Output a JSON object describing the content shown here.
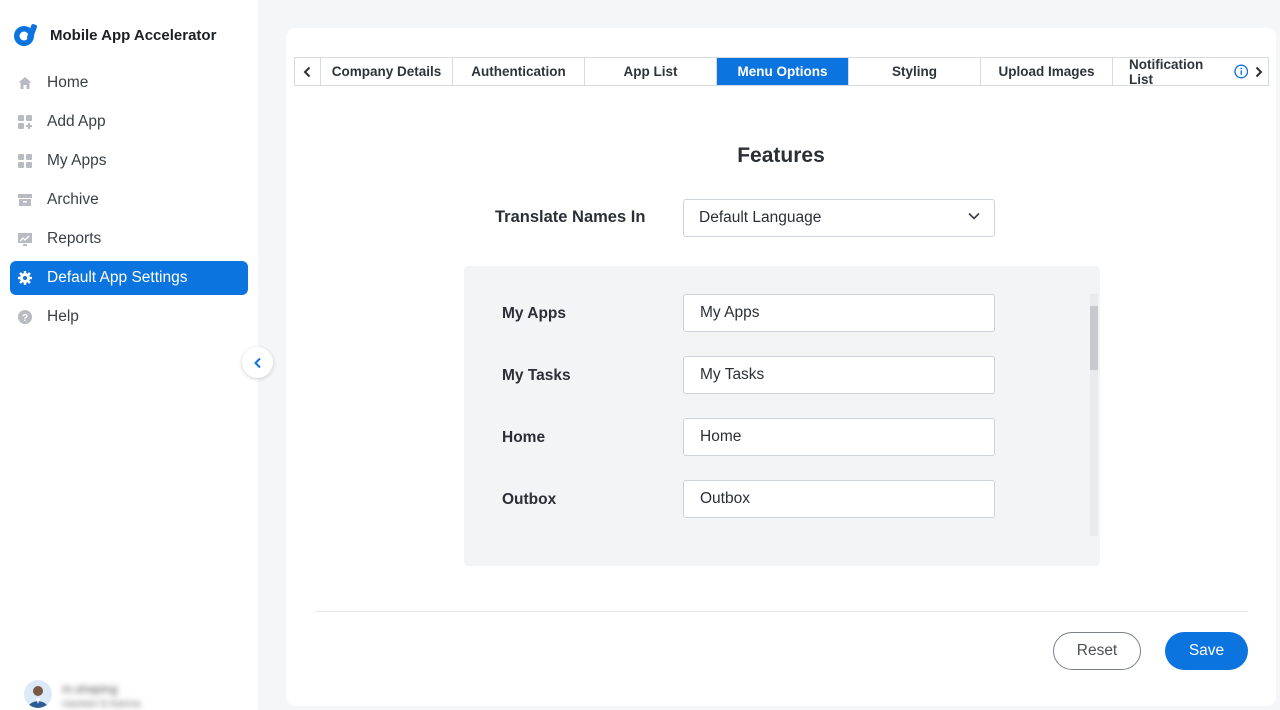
{
  "app": {
    "title": "Mobile App Accelerator",
    "accent": "#0b74de"
  },
  "sidebar": {
    "items": [
      {
        "label": "Home",
        "icon": "home-icon"
      },
      {
        "label": "Add App",
        "icon": "add-app-icon"
      },
      {
        "label": "My Apps",
        "icon": "apps-grid-icon"
      },
      {
        "label": "Archive",
        "icon": "archive-icon"
      },
      {
        "label": "Reports",
        "icon": "reports-icon"
      },
      {
        "label": "Default App Settings",
        "icon": "gear-icon",
        "active": true
      },
      {
        "label": "Help",
        "icon": "help-icon"
      }
    ],
    "user": {
      "name": "m.shaping",
      "role": "naveen b kanna"
    }
  },
  "tabs": {
    "items": [
      "Company Details",
      "Authentication",
      "App List",
      "Menu Options",
      "Styling",
      "Upload Images",
      "Notification List"
    ],
    "active": "Menu Options"
  },
  "main": {
    "title": "Features",
    "translate_label": "Translate Names In",
    "language_selected": "Default Language",
    "rows": [
      {
        "label": "My Apps",
        "value": "My Apps"
      },
      {
        "label": "My Tasks",
        "value": "My Tasks"
      },
      {
        "label": "Home",
        "value": "Home"
      },
      {
        "label": "Outbox",
        "value": "Outbox"
      }
    ]
  },
  "actions": {
    "reset_label": "Reset",
    "save_label": "Save"
  }
}
